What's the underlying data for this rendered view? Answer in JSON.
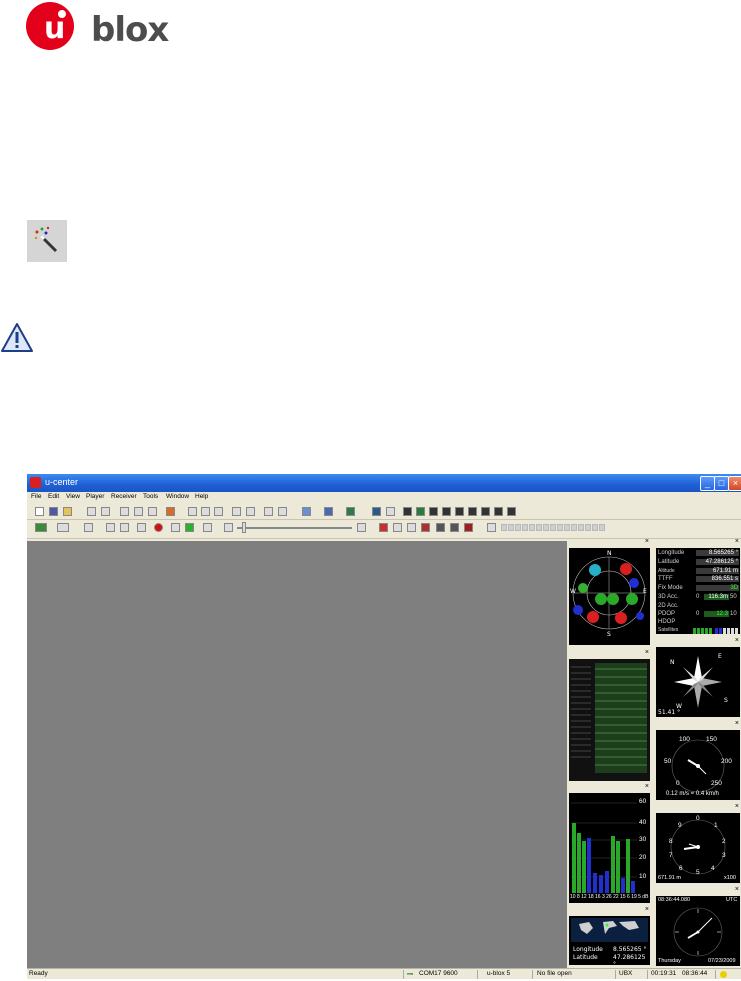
{
  "doc": {
    "logo_text": "blox",
    "logo_letter": "u"
  },
  "window": {
    "title": "u-center",
    "menu": [
      "File",
      "Edit",
      "View",
      "Player",
      "Receiver",
      "Tools",
      "Window",
      "Help"
    ]
  },
  "nav": {
    "longitude_label": "Longitude",
    "longitude": "8.565265 °",
    "latitude_label": "Latitude",
    "latitude": "47.286125 °",
    "altitude_label": "Altitude",
    "altitude": "671.91 m",
    "ttff_label": "TTFF",
    "ttff": "836.551 s",
    "fixmode_label": "Fix Mode",
    "fixmode": "3D",
    "acc3d_label": "3D Acc.",
    "acc3d_left": "0",
    "acc3d": "116.3m",
    "acc3d_right": "50",
    "acc2d_label": "2D Acc.",
    "pdop_label": "PDOP",
    "pdop_left": "0",
    "pdop": "12.3",
    "pdop_right": "10",
    "hdop_label": "HDOP",
    "sats_label": "Satellites"
  },
  "compass": {
    "n": "N",
    "e": "E",
    "s": "S",
    "w": "W",
    "value": "51.41 °"
  },
  "speed": {
    "t100": "100",
    "t150": "150",
    "t50": "50",
    "t200": "200",
    "t0": "0",
    "t250": "250",
    "readout": "0.12 m/s = 0.4 km/h"
  },
  "altimeter": {
    "n0": "0",
    "n1": "1",
    "n2": "2",
    "n3": "3",
    "n4": "4",
    "n5": "5",
    "n6": "6",
    "n7": "7",
    "n8": "8",
    "n9": "9",
    "alt": "671.91 m",
    "mult": "x100"
  },
  "clock": {
    "time": "08:36:44.080",
    "zone": "UTC",
    "day": "Thursday",
    "date": "07/23/2009"
  },
  "signal": {
    "y60": "60",
    "y40": "40",
    "y30": "30",
    "y20": "20",
    "y10": "10",
    "xlabels": "10 8 12 18 16 3 26 22 15 6 19 5 dB"
  },
  "mapview": {
    "lon_label": "Longitude",
    "lon": "8.565265 °",
    "lat_label": "Latitude",
    "lat": "47.286125 °"
  },
  "status": {
    "ready": "Ready",
    "port": "COM17 9600",
    "receiver": "u-blox 5",
    "file": "No file open",
    "protocol": "UBX",
    "elapsed": "00:19:31",
    "clock": "08:36:44"
  },
  "colors": {
    "accent": "#e2001a",
    "titlebar": "#1f5fd4",
    "workspace": "#7f7f7f"
  }
}
